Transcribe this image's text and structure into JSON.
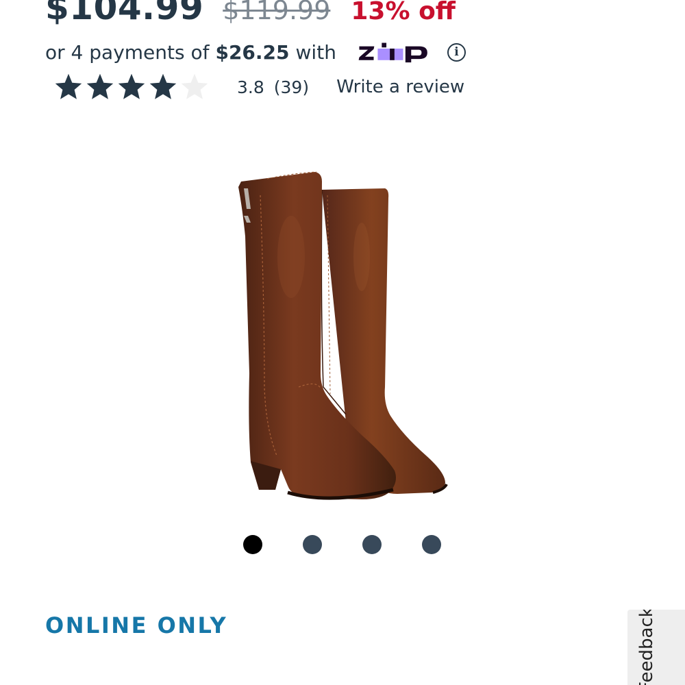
{
  "price": {
    "current": "$104.99",
    "original": "$119.99",
    "discount": "13% off"
  },
  "installments": {
    "prefix": "or 4 payments of",
    "amount": "$26.25",
    "suffix": "with",
    "provider": "Zip",
    "info_icon": "info-icon"
  },
  "rating": {
    "value": 3.8,
    "score_text": "3.8",
    "count_text": "(39)",
    "stars_filled": 4,
    "stars_total": 5,
    "write_review": "Write a review"
  },
  "carousel": {
    "total_slides": 4,
    "active_index": 0
  },
  "product": {
    "image_icon": "brown-tall-boots-image",
    "badge": "ONLINE ONLY"
  },
  "feedback": {
    "label": "Feedback"
  },
  "colors": {
    "text": "#253746",
    "discount": "#c8102e",
    "badge": "#1677a8",
    "zip_purple": "#aa8fff",
    "zip_dark": "#1a0826"
  }
}
